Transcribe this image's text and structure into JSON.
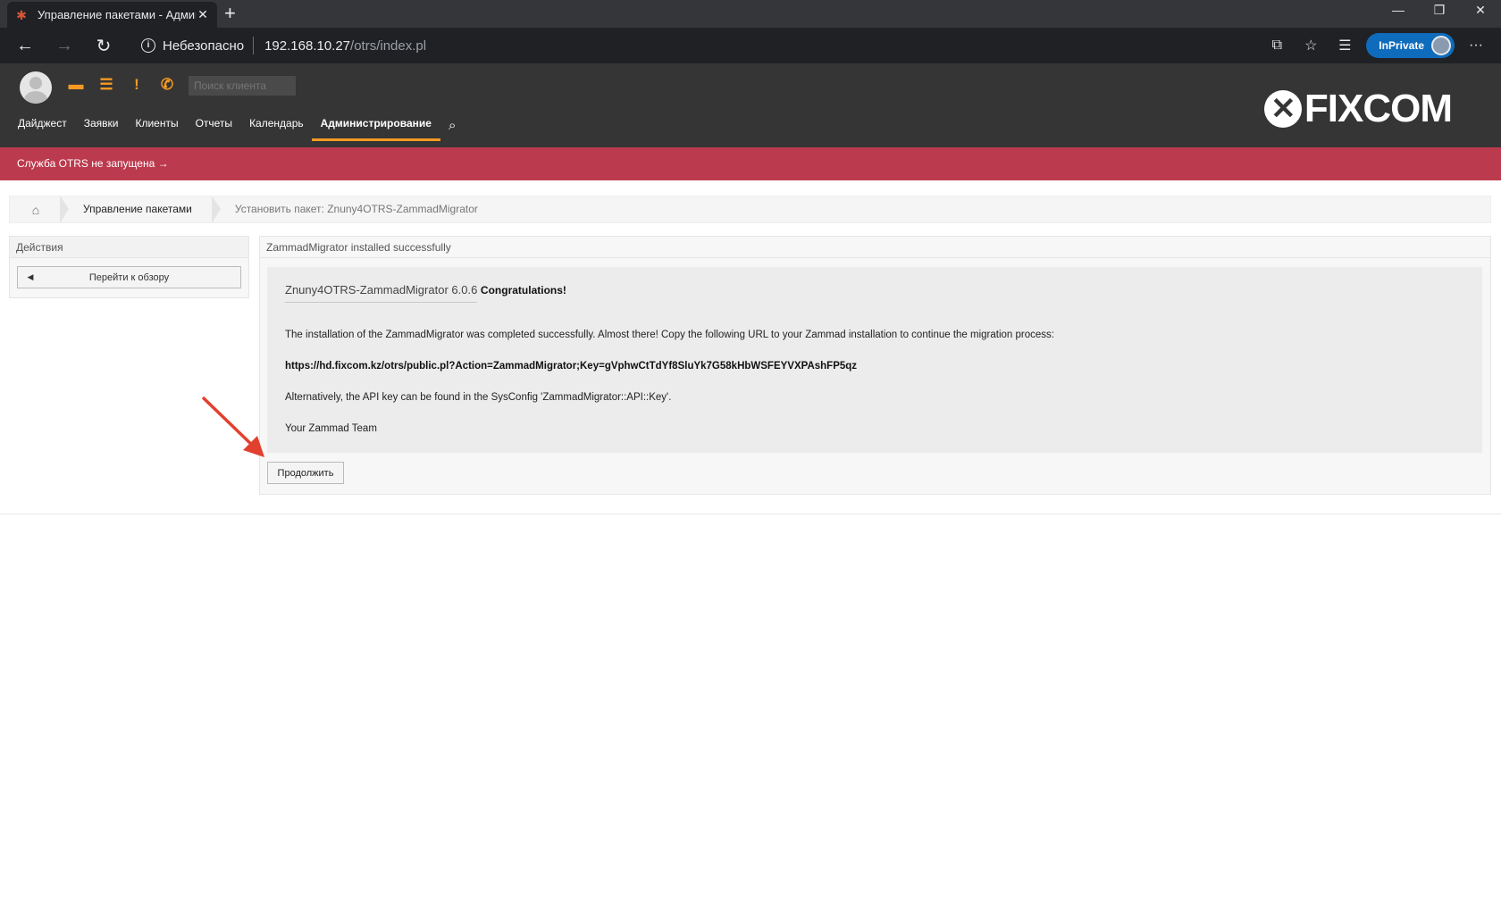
{
  "browser": {
    "tab_title": "Управление пакетами - Админ",
    "tab_close": "✕",
    "new_tab": "+",
    "win_min": "—",
    "win_max": "❐",
    "win_close": "✕",
    "security_label": "Небезопасно",
    "url_host": "192.168.10.27",
    "url_path": "/otrs/index.pl",
    "inprivate_label": "InPrivate",
    "more": "···"
  },
  "header": {
    "customer_search_placeholder": "Поиск клиента",
    "nav": [
      "Дайджест",
      "Заявки",
      "Клиенты",
      "Отчеты",
      "Календарь",
      "Администрирование"
    ],
    "logo_text": "FIXCOM",
    "accent_color": "#f59a23"
  },
  "alert": {
    "text": "Служба OTRS не запущена →",
    "color": "#bc3a4e"
  },
  "breadcrumb": {
    "items": [
      "Управление пакетами",
      "Установить пакет: Znuny4OTRS-ZammadMigrator"
    ]
  },
  "sidebar": {
    "title": "Действия",
    "go_overview": "Перейти к обзору"
  },
  "content": {
    "header": "ZammadMigrator installed successfully",
    "package_name": "Znuny4OTRS-ZammadMigrator 6.0.6",
    "congrats": "Congratulations!",
    "line1": "The installation of the ZammadMigrator was completed successfully. Almost there! Copy the following URL to your Zammad installation to continue the migration process:",
    "url": "https://hd.fixcom.kz/otrs/public.pl?Action=ZammadMigrator;Key=gVphwCtTdYf8SluYk7G58kHbWSFEYVXPAshFP5qz",
    "line2": "Alternatively, the API key can be found in the SysConfig 'ZammadMigrator::API::Key'.",
    "signature": "Your Zammad Team",
    "continue_button": "Продолжить"
  },
  "annotation": {
    "arrow_color": "#e2402f"
  }
}
